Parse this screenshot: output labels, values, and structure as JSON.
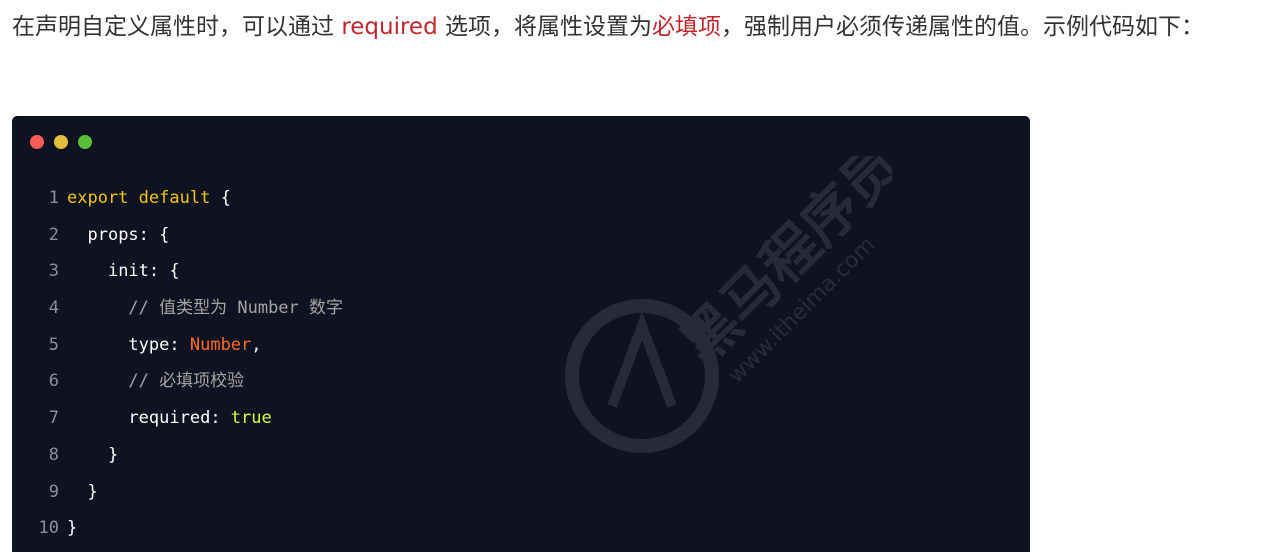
{
  "intro": {
    "before": "在声明自定义属性时，可以通过 ",
    "keyword": "required",
    "middle": " 选项，将属性设置为",
    "highlight": "必填项",
    "after": "，强制用户必须传递属性的值。示例代码如下："
  },
  "code_window": {
    "colors": {
      "background": "#0f1221",
      "dot_red": "#fc5b57",
      "dot_yellow": "#e5bf3c",
      "dot_green": "#57c038"
    },
    "lines": [
      {
        "num": "1",
        "indent": "",
        "tokens": [
          {
            "t": "export",
            "c": "kw"
          },
          {
            "t": " ",
            "c": "pn"
          },
          {
            "t": "default",
            "c": "kw"
          },
          {
            "t": " {",
            "c": "pn"
          }
        ]
      },
      {
        "num": "2",
        "indent": "  ",
        "tokens": [
          {
            "t": "props",
            "c": "id"
          },
          {
            "t": ": {",
            "c": "pn"
          }
        ]
      },
      {
        "num": "3",
        "indent": "    ",
        "tokens": [
          {
            "t": "init",
            "c": "id"
          },
          {
            "t": ": {",
            "c": "pn"
          }
        ]
      },
      {
        "num": "4",
        "indent": "      ",
        "tokens": [
          {
            "t": "// 值类型为 Number 数字",
            "c": "cm"
          }
        ]
      },
      {
        "num": "5",
        "indent": "      ",
        "tokens": [
          {
            "t": "type",
            "c": "id"
          },
          {
            "t": ": ",
            "c": "pn"
          },
          {
            "t": "Number",
            "c": "ty"
          },
          {
            "t": ",",
            "c": "pn"
          }
        ]
      },
      {
        "num": "6",
        "indent": "      ",
        "tokens": [
          {
            "t": "// 必填项校验",
            "c": "cm"
          }
        ]
      },
      {
        "num": "7",
        "indent": "      ",
        "tokens": [
          {
            "t": "required",
            "c": "id"
          },
          {
            "t": ": ",
            "c": "pn"
          },
          {
            "t": "true",
            "c": "bo"
          }
        ]
      },
      {
        "num": "8",
        "indent": "    ",
        "tokens": [
          {
            "t": "}",
            "c": "pn"
          }
        ]
      },
      {
        "num": "9",
        "indent": "  ",
        "tokens": [
          {
            "t": "}",
            "c": "pn"
          }
        ]
      },
      {
        "num": "10",
        "indent": "",
        "tokens": [
          {
            "t": "}",
            "c": "pn"
          }
        ]
      }
    ]
  },
  "watermark": {
    "text_cn": "黑马程序员",
    "text_url": "www.itheima.com"
  }
}
